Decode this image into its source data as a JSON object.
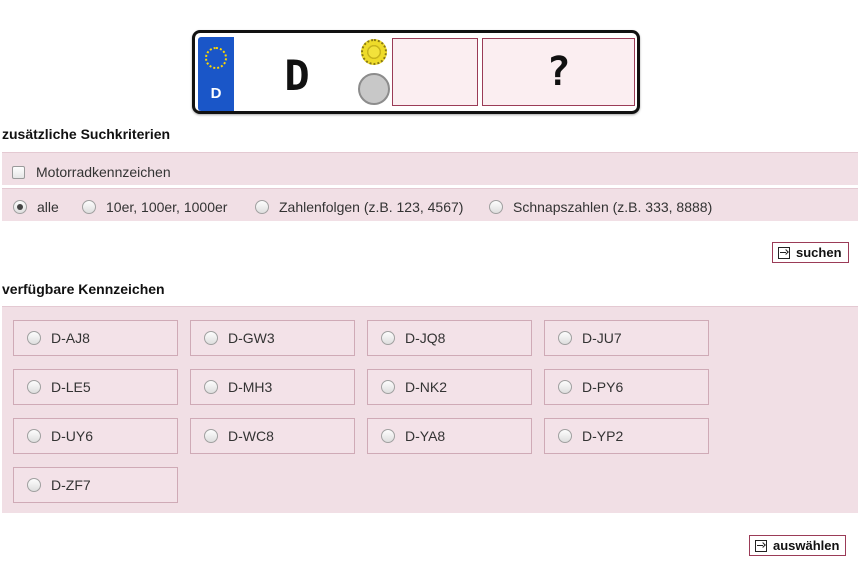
{
  "plate": {
    "country_code": "D",
    "district": "D",
    "letters": "",
    "numbers": "?"
  },
  "search_criteria": {
    "heading": "zusätzliche Suchkriterien",
    "motorcycle_label": "Motorradkennzeichen",
    "motorcycle_checked": false,
    "filters": [
      {
        "label": "alle",
        "checked": true
      },
      {
        "label": "10er, 100er, 1000er",
        "checked": false
      },
      {
        "label": "Zahlenfolgen (z.B. 123, 4567)",
        "checked": false
      },
      {
        "label": "Schnapszahlen (z.B. 333, 8888)",
        "checked": false
      }
    ],
    "search_button": "suchen"
  },
  "available": {
    "heading": "verfügbare Kennzeichen",
    "plates": [
      "D-AJ8",
      "D-GW3",
      "D-JQ8",
      "D-JU7",
      "D-LE5",
      "D-MH3",
      "D-NK2",
      "D-PY6",
      "D-UY6",
      "D-WC8",
      "D-YA8",
      "D-YP2",
      "D-ZF7"
    ],
    "select_button": "auswählen"
  },
  "colors": {
    "accent_border": "#9b3b57",
    "panel_background": "#f1dfe5",
    "eu_blue": "#1a56c8"
  }
}
